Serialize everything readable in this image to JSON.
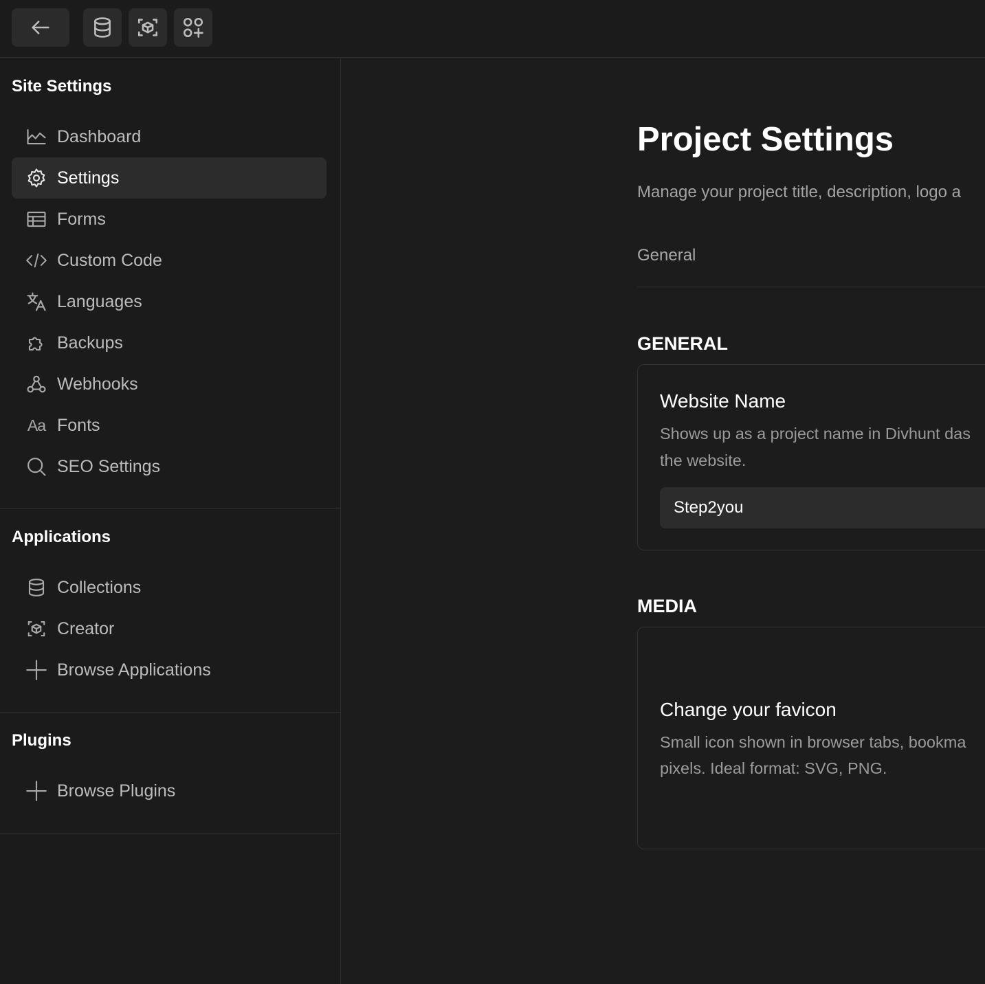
{
  "topbar": {
    "buttons": [
      {
        "name": "back",
        "icon": "arrow-left-icon"
      },
      {
        "name": "collections",
        "icon": "database-icon"
      },
      {
        "name": "creator",
        "icon": "cube-scan-icon"
      },
      {
        "name": "apps",
        "icon": "apps-add-icon"
      }
    ]
  },
  "sidebar": {
    "site_settings": {
      "title": "Site Settings",
      "items": [
        {
          "label": "Dashboard",
          "icon": "chart-line-icon"
        },
        {
          "label": "Settings",
          "icon": "gear-icon",
          "active": true
        },
        {
          "label": "Forms",
          "icon": "table-icon"
        },
        {
          "label": "Custom Code",
          "icon": "code-icon"
        },
        {
          "label": "Languages",
          "icon": "translate-icon"
        },
        {
          "label": "Backups",
          "icon": "puzzle-icon"
        },
        {
          "label": "Webhooks",
          "icon": "webhook-icon"
        },
        {
          "label": "Fonts",
          "icon": "font-icon"
        },
        {
          "label": "SEO Settings",
          "icon": "search-icon"
        }
      ]
    },
    "applications": {
      "title": "Applications",
      "items": [
        {
          "label": "Collections",
          "icon": "database-icon"
        },
        {
          "label": "Creator",
          "icon": "cube-scan-icon"
        },
        {
          "label": "Browse Applications",
          "icon": "plus-icon"
        }
      ]
    },
    "plugins": {
      "title": "Plugins",
      "items": [
        {
          "label": "Browse Plugins",
          "icon": "plus-icon"
        }
      ]
    }
  },
  "main": {
    "title": "Project Settings",
    "subtitle": "Manage your project title, description, logo a",
    "tab": "General",
    "general": {
      "heading": "GENERAL",
      "website_name": {
        "title": "Website Name",
        "description_line1": "Shows up as a project name in Divhunt das",
        "description_line2": "the website.",
        "value": "Step2you"
      }
    },
    "media": {
      "heading": "MEDIA",
      "favicon": {
        "title": "Change your favicon",
        "description_line1": "Small icon shown in browser tabs, bookma",
        "description_line2": "pixels. Ideal format: SVG, PNG."
      }
    }
  }
}
